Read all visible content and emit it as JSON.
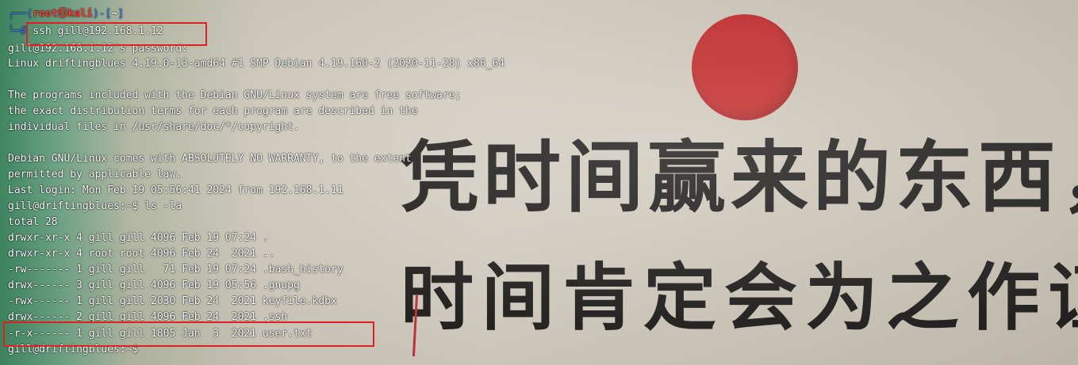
{
  "wallpaper": {
    "line1": "凭时间赢来的东西，",
    "line2": "时间肯定会为之作证"
  },
  "terminal": {
    "prompt": {
      "corner_top": "┌──(",
      "user": "root",
      "skull": "㉿",
      "host": "kali",
      "sep": ")-[",
      "dir": "~",
      "close": "]",
      "corner_bottom": "└─",
      "hash": "#",
      "command": " ssh gill@192.168.1.12"
    },
    "lines": [
      "gill@192.168.1.12's password:",
      "Linux driftingblues 4.19.0-13-amd64 #1 SMP Debian 4.19.160-2 (2020-11-28) x86_64",
      "",
      "The programs included with the Debian GNU/Linux system are free software;",
      "the exact distribution terms for each program are described in the",
      "individual files in /usr/share/doc/*/copyright.",
      "",
      "Debian GNU/Linux comes with ABSOLUTELY NO WARRANTY, to the extent",
      "permitted by applicable law.",
      "Last login: Mon Feb 19 05:56:41 2024 from 192.168.1.11",
      "gill@driftingblues:~$ ls -la",
      "total 28",
      "drwxr-xr-x 4 gill gill 4096 Feb 19 07:24 .",
      "drwxr-xr-x 4 root root 4096 Feb 24  2021 ..",
      "-rw------- 1 gill gill   71 Feb 19 07:24 .bash_history",
      "drwx------ 3 gill gill 4096 Feb 19 05:56 .gnupg",
      "-rwx------ 1 gill gill 2030 Feb 24  2021 keyfile.kdbx",
      "drwx------ 2 gill gill 4096 Feb 24  2021 .ssh",
      "-r-x------ 1 gill gill 1805 Jan  3  2021 user.txt",
      "gill@driftingblues:~$"
    ]
  },
  "colors": {
    "highlight": "#e02020",
    "prompt_blue": "#3b78ff",
    "prompt_red": "#ff3b3b",
    "sun": "#c42b2b"
  }
}
